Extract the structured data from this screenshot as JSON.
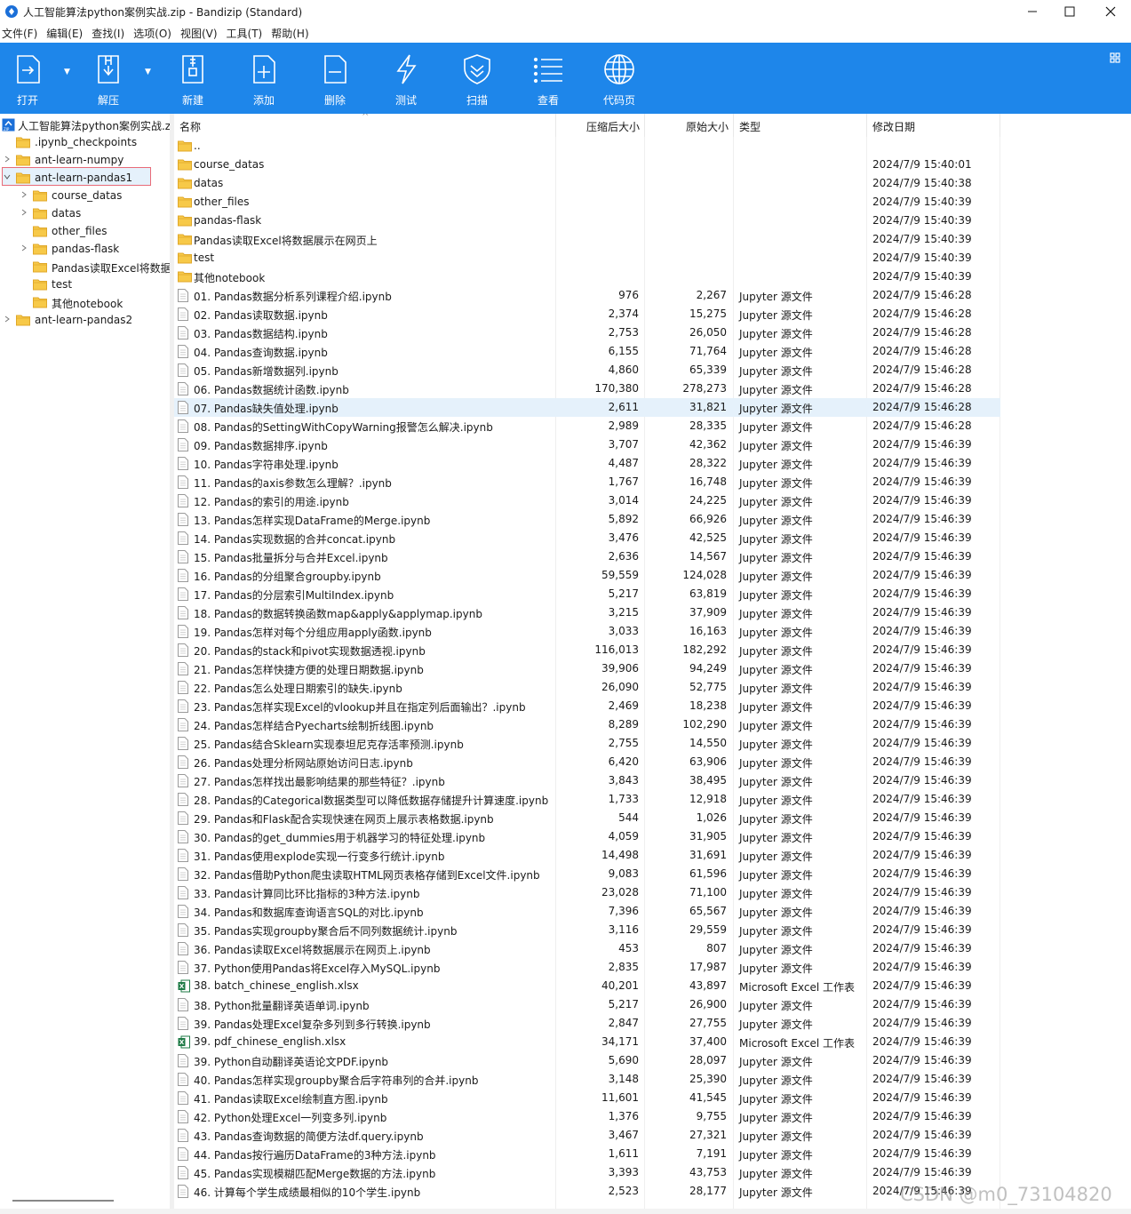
{
  "window": {
    "title": "人工智能算法python案例实战.zip - Bandizip (Standard)",
    "minimize_icon": "minimize-icon",
    "maximize_icon": "maximize-icon",
    "close_icon": "close-icon"
  },
  "menu": [
    "文件(F)",
    "编辑(E)",
    "查找(I)",
    "选项(O)",
    "视图(V)",
    "工具(T)",
    "帮助(H)"
  ],
  "toolbar": {
    "color": "#1e86ea",
    "buttons": [
      {
        "label": "打开",
        "icon": "open-icon"
      },
      {
        "label": "解压",
        "icon": "extract-icon"
      },
      {
        "label": "新建",
        "icon": "new-archive-icon"
      },
      {
        "label": "添加",
        "icon": "add-file-icon"
      },
      {
        "label": "删除",
        "icon": "delete-file-icon"
      },
      {
        "label": "测试",
        "icon": "test-lightning-icon"
      },
      {
        "label": "扫描",
        "icon": "scan-shield-icon"
      },
      {
        "label": "查看",
        "icon": "view-list-icon"
      },
      {
        "label": "代码页",
        "icon": "codepage-globe-icon"
      }
    ]
  },
  "tree": {
    "root": "人工智能算法python案例实战.zip",
    "items": [
      {
        "label": ".ipynb_checkpoints",
        "chevron": ""
      },
      {
        "label": "ant-learn-numpy",
        "chevron": "›"
      },
      {
        "label": "ant-learn-pandas1",
        "chevron": "⌄"
      },
      {
        "label": "course_datas",
        "chevron": "›"
      },
      {
        "label": "datas",
        "chevron": "›"
      },
      {
        "label": "other_files",
        "chevron": ""
      },
      {
        "label": "pandas-flask",
        "chevron": "›"
      },
      {
        "label": "Pandas读取Excel将数据展示在网页上",
        "chevron": ""
      },
      {
        "label": "test",
        "chevron": ""
      },
      {
        "label": "其他notebook",
        "chevron": ""
      },
      {
        "label": "ant-learn-pandas2",
        "chevron": "›"
      }
    ]
  },
  "columns": {
    "name": "名称",
    "compressed": "压缩后大小",
    "original": "原始大小",
    "type": "类型",
    "modified": "修改日期"
  },
  "rows": [
    {
      "kind": "folder",
      "name": "..",
      "comp": "",
      "orig": "",
      "type": "",
      "date": ""
    },
    {
      "kind": "folder",
      "name": "course_datas",
      "comp": "",
      "orig": "",
      "type": "",
      "date": "2024/7/9 15:40:01"
    },
    {
      "kind": "folder",
      "name": "datas",
      "comp": "",
      "orig": "",
      "type": "",
      "date": "2024/7/9 15:40:38"
    },
    {
      "kind": "folder",
      "name": "other_files",
      "comp": "",
      "orig": "",
      "type": "",
      "date": "2024/7/9 15:40:39"
    },
    {
      "kind": "folder",
      "name": "pandas-flask",
      "comp": "",
      "orig": "",
      "type": "",
      "date": "2024/7/9 15:40:39"
    },
    {
      "kind": "folder",
      "name": "Pandas读取Excel将数据展示在网页上",
      "comp": "",
      "orig": "",
      "type": "",
      "date": "2024/7/9 15:40:39"
    },
    {
      "kind": "folder",
      "name": "test",
      "comp": "",
      "orig": "",
      "type": "",
      "date": "2024/7/9 15:40:39"
    },
    {
      "kind": "folder",
      "name": "其他notebook",
      "comp": "",
      "orig": "",
      "type": "",
      "date": "2024/7/9 15:40:39"
    },
    {
      "kind": "file",
      "name": "01. Pandas数据分析系列课程介绍.ipynb",
      "comp": "976",
      "orig": "2,267",
      "type": "Jupyter 源文件",
      "date": "2024/7/9 15:46:28"
    },
    {
      "kind": "file",
      "name": "02. Pandas读取数据.ipynb",
      "comp": "2,374",
      "orig": "15,275",
      "type": "Jupyter 源文件",
      "date": "2024/7/9 15:46:28"
    },
    {
      "kind": "file",
      "name": "03. Pandas数据结构.ipynb",
      "comp": "2,753",
      "orig": "26,050",
      "type": "Jupyter 源文件",
      "date": "2024/7/9 15:46:28"
    },
    {
      "kind": "file",
      "name": "04. Pandas查询数据.ipynb",
      "comp": "6,155",
      "orig": "71,764",
      "type": "Jupyter 源文件",
      "date": "2024/7/9 15:46:28"
    },
    {
      "kind": "file",
      "name": "05. Pandas新增数据列.ipynb",
      "comp": "4,860",
      "orig": "65,339",
      "type": "Jupyter 源文件",
      "date": "2024/7/9 15:46:28"
    },
    {
      "kind": "file",
      "name": "06. Pandas数据统计函数.ipynb",
      "comp": "170,380",
      "orig": "278,273",
      "type": "Jupyter 源文件",
      "date": "2024/7/9 15:46:28"
    },
    {
      "kind": "file",
      "name": "07. Pandas缺失值处理.ipynb",
      "comp": "2,611",
      "orig": "31,821",
      "type": "Jupyter 源文件",
      "date": "2024/7/9 15:46:28",
      "selected": true
    },
    {
      "kind": "file",
      "name": "08. Pandas的SettingWithCopyWarning报警怎么解决.ipynb",
      "comp": "2,989",
      "orig": "28,335",
      "type": "Jupyter 源文件",
      "date": "2024/7/9 15:46:28"
    },
    {
      "kind": "file",
      "name": "09. Pandas数据排序.ipynb",
      "comp": "3,707",
      "orig": "42,362",
      "type": "Jupyter 源文件",
      "date": "2024/7/9 15:46:39"
    },
    {
      "kind": "file",
      "name": "10. Pandas字符串处理.ipynb",
      "comp": "4,487",
      "orig": "28,322",
      "type": "Jupyter 源文件",
      "date": "2024/7/9 15:46:39"
    },
    {
      "kind": "file",
      "name": "11. Pandas的axis参数怎么理解？.ipynb",
      "comp": "1,767",
      "orig": "16,748",
      "type": "Jupyter 源文件",
      "date": "2024/7/9 15:46:39"
    },
    {
      "kind": "file",
      "name": "12. Pandas的索引的用途.ipynb",
      "comp": "3,014",
      "orig": "24,225",
      "type": "Jupyter 源文件",
      "date": "2024/7/9 15:46:39"
    },
    {
      "kind": "file",
      "name": "13. Pandas怎样实现DataFrame的Merge.ipynb",
      "comp": "5,892",
      "orig": "66,926",
      "type": "Jupyter 源文件",
      "date": "2024/7/9 15:46:39"
    },
    {
      "kind": "file",
      "name": "14. Pandas实现数据的合并concat.ipynb",
      "comp": "3,476",
      "orig": "42,525",
      "type": "Jupyter 源文件",
      "date": "2024/7/9 15:46:39"
    },
    {
      "kind": "file",
      "name": "15. Pandas批量拆分与合并Excel.ipynb",
      "comp": "2,636",
      "orig": "14,567",
      "type": "Jupyter 源文件",
      "date": "2024/7/9 15:46:39"
    },
    {
      "kind": "file",
      "name": "16. Pandas的分组聚合groupby.ipynb",
      "comp": "59,559",
      "orig": "124,028",
      "type": "Jupyter 源文件",
      "date": "2024/7/9 15:46:39"
    },
    {
      "kind": "file",
      "name": "17. Pandas的分层索引MultiIndex.ipynb",
      "comp": "5,217",
      "orig": "63,819",
      "type": "Jupyter 源文件",
      "date": "2024/7/9 15:46:39"
    },
    {
      "kind": "file",
      "name": "18. Pandas的数据转换函数map&apply&applymap.ipynb",
      "comp": "3,215",
      "orig": "37,909",
      "type": "Jupyter 源文件",
      "date": "2024/7/9 15:46:39"
    },
    {
      "kind": "file",
      "name": "19. Pandas怎样对每个分组应用apply函数.ipynb",
      "comp": "3,033",
      "orig": "16,163",
      "type": "Jupyter 源文件",
      "date": "2024/7/9 15:46:39"
    },
    {
      "kind": "file",
      "name": "20. Pandas的stack和pivot实现数据透视.ipynb",
      "comp": "116,013",
      "orig": "182,292",
      "type": "Jupyter 源文件",
      "date": "2024/7/9 15:46:39"
    },
    {
      "kind": "file",
      "name": "21. Pandas怎样快捷方便的处理日期数据.ipynb",
      "comp": "39,906",
      "orig": "94,249",
      "type": "Jupyter 源文件",
      "date": "2024/7/9 15:46:39"
    },
    {
      "kind": "file",
      "name": "22. Pandas怎么处理日期索引的缺失.ipynb",
      "comp": "26,090",
      "orig": "52,775",
      "type": "Jupyter 源文件",
      "date": "2024/7/9 15:46:39"
    },
    {
      "kind": "file",
      "name": "23. Pandas怎样实现Excel的vlookup并且在指定列后面输出？.ipynb",
      "comp": "2,469",
      "orig": "18,238",
      "type": "Jupyter 源文件",
      "date": "2024/7/9 15:46:39"
    },
    {
      "kind": "file",
      "name": "24. Pandas怎样结合Pyecharts绘制折线图.ipynb",
      "comp": "8,289",
      "orig": "102,290",
      "type": "Jupyter 源文件",
      "date": "2024/7/9 15:46:39"
    },
    {
      "kind": "file",
      "name": "25. Pandas结合Sklearn实现泰坦尼克存活率预测.ipynb",
      "comp": "2,755",
      "orig": "14,550",
      "type": "Jupyter 源文件",
      "date": "2024/7/9 15:46:39"
    },
    {
      "kind": "file",
      "name": "26. Pandas处理分析网站原始访问日志.ipynb",
      "comp": "6,420",
      "orig": "63,906",
      "type": "Jupyter 源文件",
      "date": "2024/7/9 15:46:39"
    },
    {
      "kind": "file",
      "name": "27. Pandas怎样找出最影响结果的那些特征？.ipynb",
      "comp": "3,843",
      "orig": "38,495",
      "type": "Jupyter 源文件",
      "date": "2024/7/9 15:46:39"
    },
    {
      "kind": "file",
      "name": "28. Pandas的Categorical数据类型可以降低数据存储提升计算速度.ipynb",
      "comp": "1,733",
      "orig": "12,918",
      "type": "Jupyter 源文件",
      "date": "2024/7/9 15:46:39"
    },
    {
      "kind": "file",
      "name": "29. Pandas和Flask配合实现快速在网页上展示表格数据.ipynb",
      "comp": "544",
      "orig": "1,026",
      "type": "Jupyter 源文件",
      "date": "2024/7/9 15:46:39"
    },
    {
      "kind": "file",
      "name": "30. Pandas的get_dummies用于机器学习的特征处理.ipynb",
      "comp": "4,059",
      "orig": "31,905",
      "type": "Jupyter 源文件",
      "date": "2024/7/9 15:46:39"
    },
    {
      "kind": "file",
      "name": "31. Pandas使用explode实现一行变多行统计.ipynb",
      "comp": "14,498",
      "orig": "31,691",
      "type": "Jupyter 源文件",
      "date": "2024/7/9 15:46:39"
    },
    {
      "kind": "file",
      "name": "32. Pandas借助Python爬虫读取HTML网页表格存储到Excel文件.ipynb",
      "comp": "9,083",
      "orig": "61,596",
      "type": "Jupyter 源文件",
      "date": "2024/7/9 15:46:39"
    },
    {
      "kind": "file",
      "name": "33. Pandas计算同比环比指标的3种方法.ipynb",
      "comp": "23,028",
      "orig": "71,100",
      "type": "Jupyter 源文件",
      "date": "2024/7/9 15:46:39"
    },
    {
      "kind": "file",
      "name": "34. Pandas和数据库查询语言SQL的对比.ipynb",
      "comp": "7,396",
      "orig": "65,567",
      "type": "Jupyter 源文件",
      "date": "2024/7/9 15:46:39"
    },
    {
      "kind": "file",
      "name": "35. Pandas实现groupby聚合后不同列数据统计.ipynb",
      "comp": "3,116",
      "orig": "29,559",
      "type": "Jupyter 源文件",
      "date": "2024/7/9 15:46:39"
    },
    {
      "kind": "file",
      "name": "36. Pandas读取Excel将数据展示在网页上.ipynb",
      "comp": "453",
      "orig": "807",
      "type": "Jupyter 源文件",
      "date": "2024/7/9 15:46:39"
    },
    {
      "kind": "file",
      "name": "37. Python使用Pandas将Excel存入MySQL.ipynb",
      "comp": "2,835",
      "orig": "17,987",
      "type": "Jupyter 源文件",
      "date": "2024/7/9 15:46:39"
    },
    {
      "kind": "excel",
      "name": "38. batch_chinese_english.xlsx",
      "comp": "40,201",
      "orig": "43,897",
      "type": "Microsoft Excel 工作表",
      "date": "2024/7/9 15:46:39"
    },
    {
      "kind": "file",
      "name": "38. Python批量翻译英语单词.ipynb",
      "comp": "5,217",
      "orig": "26,900",
      "type": "Jupyter 源文件",
      "date": "2024/7/9 15:46:39"
    },
    {
      "kind": "file",
      "name": "39. Pandas处理Excel复杂多列到多行转换.ipynb",
      "comp": "2,847",
      "orig": "27,755",
      "type": "Jupyter 源文件",
      "date": "2024/7/9 15:46:39"
    },
    {
      "kind": "excel",
      "name": "39. pdf_chinese_english.xlsx",
      "comp": "34,171",
      "orig": "37,400",
      "type": "Microsoft Excel 工作表",
      "date": "2024/7/9 15:46:39"
    },
    {
      "kind": "file",
      "name": "39. Python自动翻译英语论文PDF.ipynb",
      "comp": "5,690",
      "orig": "28,097",
      "type": "Jupyter 源文件",
      "date": "2024/7/9 15:46:39"
    },
    {
      "kind": "file",
      "name": "40. Pandas怎样实现groupby聚合后字符串列的合并.ipynb",
      "comp": "3,148",
      "orig": "25,390",
      "type": "Jupyter 源文件",
      "date": "2024/7/9 15:46:39"
    },
    {
      "kind": "file",
      "name": "41. Pandas读取Excel绘制直方图.ipynb",
      "comp": "11,601",
      "orig": "41,545",
      "type": "Jupyter 源文件",
      "date": "2024/7/9 15:46:39"
    },
    {
      "kind": "file",
      "name": "42. Python处理Excel一列变多列.ipynb",
      "comp": "1,376",
      "orig": "9,755",
      "type": "Jupyter 源文件",
      "date": "2024/7/9 15:46:39"
    },
    {
      "kind": "file",
      "name": "43. Pandas查询数据的简便方法df.query.ipynb",
      "comp": "3,467",
      "orig": "27,321",
      "type": "Jupyter 源文件",
      "date": "2024/7/9 15:46:39"
    },
    {
      "kind": "file",
      "name": "44. Pandas按行遍历DataFrame的3种方法.ipynb",
      "comp": "1,611",
      "orig": "7,191",
      "type": "Jupyter 源文件",
      "date": "2024/7/9 15:46:39"
    },
    {
      "kind": "file",
      "name": "45. Pandas实现模糊匹配Merge数据的方法.ipynb",
      "comp": "3,393",
      "orig": "43,753",
      "type": "Jupyter 源文件",
      "date": "2024/7/9 15:46:39"
    },
    {
      "kind": "file",
      "name": "46. 计算每个学生成绩最相似的10个学生.ipynb",
      "comp": "2,523",
      "orig": "28,177",
      "type": "Jupyter 源文件",
      "date": "2024/7/9 15:46:39"
    }
  ],
  "watermark": "CSDN @m0_73104820"
}
